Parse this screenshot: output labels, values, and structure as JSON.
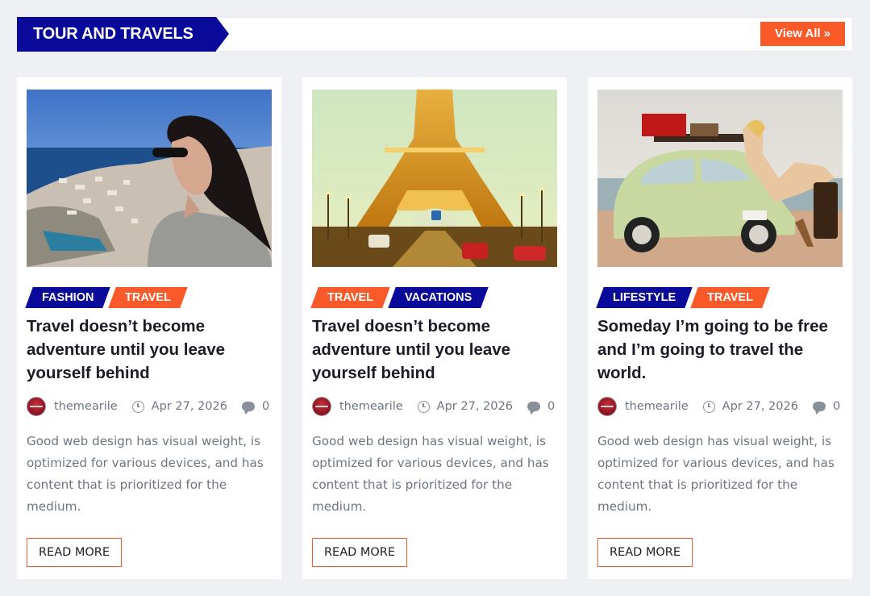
{
  "section": {
    "title": "TOUR AND TRAVELS",
    "view_all_label": "View All",
    "view_all_icon": "double-chevron-right-icon"
  },
  "colors": {
    "brand_blue": "#0a0a9a",
    "accent_orange": "#fa5a2a",
    "page_bg": "#eef0f3"
  },
  "cards": [
    {
      "image": "woman-sunglasses-coastline-photo",
      "tags": [
        "FASHION",
        "TRAVEL"
      ],
      "title": "Travel doesn’t become adventure until you leave yourself behind",
      "author": "themearile",
      "date": "Apr 27, 2026",
      "comments": "0",
      "excerpt": "Good web design has visual weight, is optimized for various devices, and has content that is prioritized for the medium.",
      "read_more": "READ MORE"
    },
    {
      "image": "eiffel-tower-night-street-photo",
      "tags": [
        "TRAVEL",
        "VACATIONS"
      ],
      "title": "Travel doesn’t become adventure until you leave yourself behind",
      "author": "themearile",
      "date": "Apr 27, 2026",
      "comments": "0",
      "excerpt": "Good web design has visual weight, is optimized for various devices, and has content that is prioritized for the medium.",
      "read_more": "READ MORE"
    },
    {
      "image": "vintage-beetle-beach-woman-photo",
      "tags": [
        "LIFESTYLE",
        "TRAVEL"
      ],
      "title": "Someday I’m going to be free and I’m going to travel the world.",
      "author": "themearile",
      "date": "Apr 27, 2026",
      "comments": "0",
      "excerpt": "Good web design has visual weight, is optimized for various devices, and has content that is prioritized for the medium.",
      "read_more": "READ MORE"
    }
  ]
}
